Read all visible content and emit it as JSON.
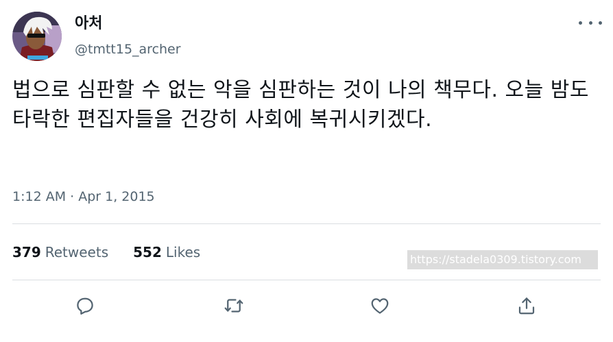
{
  "user": {
    "display_name": "아처",
    "handle": "@tmtt15_archer",
    "avatar_icon": "anime-character-avatar"
  },
  "tweet": {
    "text": "법으로 심판할 수 없는 악을 심판하는 것이 나의 책무다. 오늘 밤도 타락한 편집자들을 건강히 사회에 복귀시키겠다.",
    "timestamp": "1:12 AM · Apr 1, 2015"
  },
  "stats": {
    "retweets_count": "379",
    "retweets_label": "Retweets",
    "likes_count": "552",
    "likes_label": "Likes"
  },
  "watermark": "https://stadela0309.tistory.com",
  "actions": [
    {
      "name": "reply",
      "icon": "reply-icon"
    },
    {
      "name": "retweet",
      "icon": "retweet-icon"
    },
    {
      "name": "like",
      "icon": "heart-icon"
    },
    {
      "name": "share",
      "icon": "share-icon"
    }
  ],
  "colors": {
    "text_primary": "#0f1419",
    "text_secondary": "#536471",
    "divider": "#dadde1",
    "watermark_bg": "#dcdcdc"
  }
}
